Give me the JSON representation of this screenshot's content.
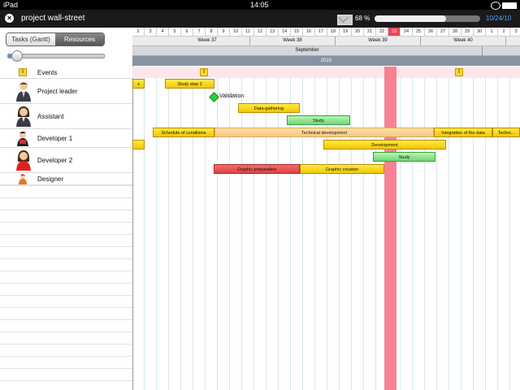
{
  "status": {
    "device": "iPad",
    "time": "14:05"
  },
  "toolbar": {
    "project_title": "project wall-street",
    "progress_text": "68 %",
    "progress_fraction": 0.68,
    "date": "10/24/10"
  },
  "view_toggle": {
    "tasks_label": "Tasks (Gantt)",
    "resources_label": "Resources"
  },
  "zoom_level": 0.08,
  "resources": [
    {
      "label": "Events",
      "icon": "warning-icon"
    },
    {
      "label": "Project leader",
      "icon": "businessman-icon"
    },
    {
      "label": "Assistant",
      "icon": "businesswoman-icon"
    },
    {
      "label": "Developer 1",
      "icon": "developer-icon"
    },
    {
      "label": "Developer 2",
      "icon": "developer-woman-icon"
    },
    {
      "label": "Designer",
      "icon": "designer-icon"
    }
  ],
  "timeline": {
    "days": [
      "2",
      "3",
      "4",
      "5",
      "6",
      "7",
      "8",
      "9",
      "10",
      "11",
      "12",
      "13",
      "14",
      "15",
      "16",
      "17",
      "18",
      "19",
      "20",
      "21",
      "22",
      "23",
      "24",
      "25",
      "26",
      "27",
      "28",
      "29",
      "30",
      "1",
      "2",
      "3"
    ],
    "weeks": [
      "Week 37",
      "Week 38",
      "Week 39",
      "Week 40"
    ],
    "month": "September",
    "year": "2010",
    "today": "23"
  },
  "tasks": {
    "project_leader": {
      "study_step": "Study step 2",
      "milestone": "Validation"
    },
    "assistant": {
      "data_gathering": "Data-gathering",
      "study": "Study"
    },
    "developer1": {
      "schedule": "Schedule of conditions",
      "technical": "Technical development",
      "integration": "Integration of the data",
      "technical_short": "Techni..."
    },
    "developer2": {
      "development": "Development",
      "study": "Study"
    },
    "designer": {
      "graphic_prep": "Graphic preparation",
      "graphic_creation": "Graphic creation"
    }
  },
  "colors": {
    "today": "#f5768a",
    "task_yellow": "#ffe94a",
    "task_green": "#7ee07e",
    "task_red": "#e85050",
    "accent": "#4aa3ff"
  }
}
